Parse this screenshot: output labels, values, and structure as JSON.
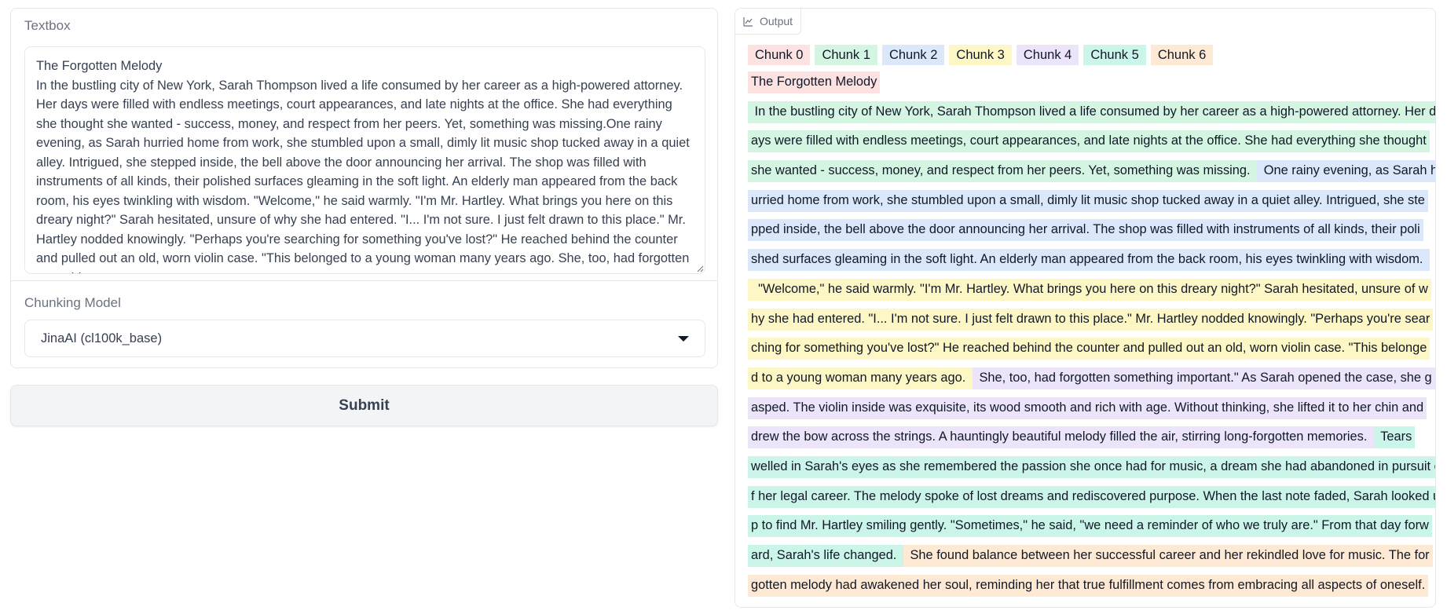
{
  "input": {
    "textbox_label": "Textbox",
    "textbox_value": "The Forgotten Melody\nIn the bustling city of New York, Sarah Thompson lived a life consumed by her career as a high-powered attorney. Her days were filled with endless meetings, court appearances, and late nights at the office. She had everything she thought she wanted - success, money, and respect from her peers. Yet, something was missing.One rainy evening, as Sarah hurried home from work, she stumbled upon a small, dimly lit music shop tucked away in a quiet alley. Intrigued, she stepped inside, the bell above the door announcing her arrival. The shop was filled with instruments of all kinds, their polished surfaces gleaming in the soft light. An elderly man appeared from the back room, his eyes twinkling with wisdom. \"Welcome,\" he said warmly. \"I'm Mr. Hartley. What brings you here on this dreary night?\" Sarah hesitated, unsure of why she had entered. \"I... I'm not sure. I just felt drawn to this place.\" Mr. Hartley nodded knowingly. \"Perhaps you're searching for something you've lost?\" He reached behind the counter and pulled out an old, worn violin case. \"This belonged to a young woman many years ago. She, too, had forgotten something",
    "model_label": "Chunking Model",
    "model_selected": "JinaAI (cl100k_base)",
    "submit_label": "Submit"
  },
  "output": {
    "label": "Output",
    "legend": [
      "Chunk 0",
      "Chunk 1",
      "Chunk 2",
      "Chunk 3",
      "Chunk 4",
      "Chunk 5",
      "Chunk 6"
    ],
    "lines": [
      [
        {
          "chunk": 0,
          "text": "The Forgotten Melody"
        }
      ],
      [
        {
          "chunk": 1,
          "text": " In the bustling city of New York, Sarah Thompson lived a life consumed by her career as a high-powered attorney. Her d"
        }
      ],
      [
        {
          "chunk": 1,
          "text": "ays were filled with endless meetings, court appearances, and late nights at the office. She had everything she thought"
        }
      ],
      [
        {
          "chunk": 1,
          "text": "she wanted - success, money, and respect from her peers. Yet, something was missing. "
        },
        {
          "chunk": 2,
          "text": " One rainy evening, as Sarah h"
        }
      ],
      [
        {
          "chunk": 2,
          "text": "urried home from work, she stumbled upon a small, dimly lit music shop tucked away in a quiet alley. Intrigued, she ste"
        }
      ],
      [
        {
          "chunk": 2,
          "text": "pped inside, the bell above the door announcing her arrival. The shop was filled with instruments of all kinds, their poli"
        }
      ],
      [
        {
          "chunk": 2,
          "text": "shed surfaces gleaming in the soft light. An elderly man appeared from the back room, his eyes twinkling with wisdom. "
        }
      ],
      [
        {
          "chunk": 3,
          "text": "  \"Welcome,\" he said warmly. \"I'm Mr. Hartley. What brings you here on this dreary night?\" Sarah hesitated, unsure of w"
        }
      ],
      [
        {
          "chunk": 3,
          "text": "hy she had entered. \"I... I'm not sure. I just felt drawn to this place.\" Mr. Hartley nodded knowingly. \"Perhaps you're sear"
        }
      ],
      [
        {
          "chunk": 3,
          "text": "ching for something you've lost?\" He reached behind the counter and pulled out an old, worn violin case. \"This belonge"
        }
      ],
      [
        {
          "chunk": 3,
          "text": "d to a young woman many years ago. "
        },
        {
          "chunk": 4,
          "text": " She, too, had forgotten something important.\" As Sarah opened the case, she g"
        }
      ],
      [
        {
          "chunk": 4,
          "text": "asped. The violin inside was exquisite, its wood smooth and rich with age. Without thinking, she lifted it to her chin and"
        }
      ],
      [
        {
          "chunk": 4,
          "text": "drew the bow across the strings. A hauntingly beautiful melody filled the air, stirring long-forgotten memories. "
        },
        {
          "chunk": 5,
          "text": " Tears"
        }
      ],
      [
        {
          "chunk": 5,
          "text": "welled in Sarah's eyes as she remembered the passion she once had for music, a dream she had abandoned in pursuit o"
        }
      ],
      [
        {
          "chunk": 5,
          "text": "f her legal career. The melody spoke of lost dreams and rediscovered purpose. When the last note faded, Sarah looked u"
        }
      ],
      [
        {
          "chunk": 5,
          "text": "p to find Mr. Hartley smiling gently. \"Sometimes,\" he said, \"we need a reminder of who we truly are.\" From that day forw"
        }
      ],
      [
        {
          "chunk": 5,
          "text": "ard, Sarah's life changed. "
        },
        {
          "chunk": 6,
          "text": " She found balance between her successful career and her rekindled love for music. The for"
        }
      ],
      [
        {
          "chunk": 6,
          "text": "gotten melody had awakened her soul, reminding her that true fulfillment comes from embracing all aspects of oneself."
        }
      ]
    ]
  },
  "colors": {
    "chunk0": "#fde2e2",
    "chunk1": "#d5f5e3",
    "chunk2": "#dbe7fb",
    "chunk3": "#fdf7c5",
    "chunk4": "#ece5f9",
    "chunk5": "#ccf5ea",
    "chunk6": "#feead4"
  },
  "icons": {
    "output_label_icon": "chart-icon",
    "dropdown_icon": "caret-down-icon",
    "resize_icon": "resize-handle-icon"
  }
}
